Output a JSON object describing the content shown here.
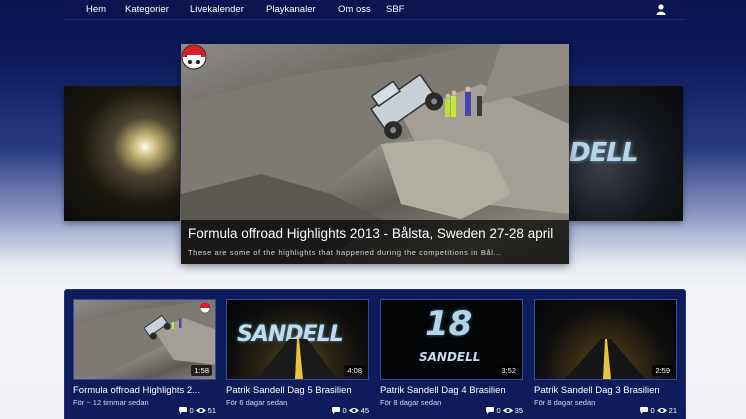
{
  "nav": {
    "items": [
      "Hem",
      "Kategorier",
      "Livekalender",
      "Playkanaler",
      "Om oss",
      "SBF"
    ],
    "user_icon": "user-icon"
  },
  "featured": {
    "title": "Formula offroad Highlights 2013 - Bålsta, Sweden 27-28 april",
    "description": "These are some of the highlights that happened during the competitions in Bål..."
  },
  "side_slides": {
    "right_wordmark": "DELL"
  },
  "videos": [
    {
      "title": "Formula offroad Highlights 2...",
      "time": "För ~ 12 timmar sedan",
      "duration": "1:58",
      "comments": "0",
      "views": "51"
    },
    {
      "title": "Patrik Sandell Dag 5 Brasilien",
      "time": "För 6 dagar sedan",
      "duration": "4:08",
      "comments": "0",
      "views": "45"
    },
    {
      "title": "Patrik Sandell Dag 4 Brasilien",
      "time": "För 8 dagar sedan",
      "duration": "3:52",
      "comments": "0",
      "views": "35"
    },
    {
      "title": "Patrik Sandell Dag 3 Brasilien",
      "time": "För 8 dagar sedan",
      "duration": "2:59",
      "comments": "0",
      "views": "21"
    }
  ],
  "thumb_text": {
    "sandell": "SANDELL",
    "number": "18"
  },
  "colors": {
    "nav_bg": "#0b1650",
    "panel_bg": "#0e1c5c",
    "caption_bg": "#000000"
  }
}
